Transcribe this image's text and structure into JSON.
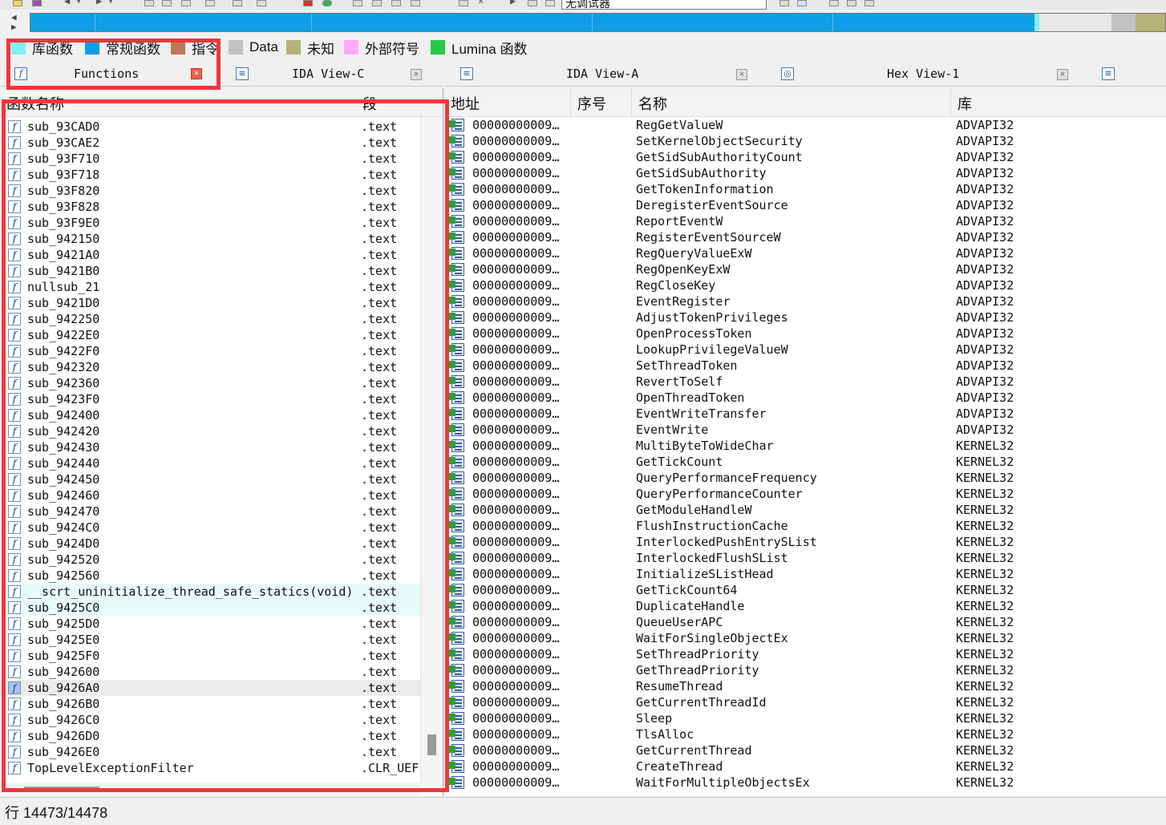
{
  "toolbar": {
    "debugger_select": "无调试器"
  },
  "colors": {
    "library_function": "#7ff0ee",
    "regular_function": "#0c9ee6",
    "instruction": "#c0765a",
    "data": "#c2c2c2",
    "unexplored": "#b5b278",
    "external_symbol": "#ffaaff",
    "lumina_function": "#26c84a",
    "redbox": "#f2353d"
  },
  "legend": [
    {
      "label": "库函数",
      "color": "#7ff0ee"
    },
    {
      "label": "常规函数",
      "color": "#0c9ee6"
    },
    {
      "label": "指令",
      "color": "#c0765a"
    },
    {
      "label": "Data",
      "color": "#c2c2c2"
    },
    {
      "label": "未知",
      "color": "#b5b278"
    },
    {
      "label": "外部符号",
      "color": "#ffaaff"
    },
    {
      "label": "Lumina 函数",
      "color": "#26c84a"
    }
  ],
  "tabs": {
    "functions": "Functions",
    "ida_view_c": "IDA View-C",
    "ida_view_a": "IDA View-A",
    "hex_view": "Hex View-1"
  },
  "functions_panel": {
    "columns": {
      "name": "函数名称",
      "segment": "段"
    },
    "rows": [
      {
        "name": "sub_93CAD0",
        "segment": ".text"
      },
      {
        "name": "sub_93CAE2",
        "segment": ".text"
      },
      {
        "name": "sub_93F710",
        "segment": ".text"
      },
      {
        "name": "sub_93F718",
        "segment": ".text"
      },
      {
        "name": "sub_93F820",
        "segment": ".text"
      },
      {
        "name": "sub_93F828",
        "segment": ".text"
      },
      {
        "name": "sub_93F9E0",
        "segment": ".text"
      },
      {
        "name": "sub_942150",
        "segment": ".text"
      },
      {
        "name": "sub_9421A0",
        "segment": ".text"
      },
      {
        "name": "sub_9421B0",
        "segment": ".text"
      },
      {
        "name": "nullsub_21",
        "segment": ".text"
      },
      {
        "name": "sub_9421D0",
        "segment": ".text"
      },
      {
        "name": "sub_942250",
        "segment": ".text"
      },
      {
        "name": "sub_9422E0",
        "segment": ".text"
      },
      {
        "name": "sub_9422F0",
        "segment": ".text"
      },
      {
        "name": "sub_942320",
        "segment": ".text"
      },
      {
        "name": "sub_942360",
        "segment": ".text"
      },
      {
        "name": "sub_9423F0",
        "segment": ".text"
      },
      {
        "name": "sub_942400",
        "segment": ".text"
      },
      {
        "name": "sub_942420",
        "segment": ".text"
      },
      {
        "name": "sub_942430",
        "segment": ".text"
      },
      {
        "name": "sub_942440",
        "segment": ".text"
      },
      {
        "name": "sub_942450",
        "segment": ".text"
      },
      {
        "name": "sub_942460",
        "segment": ".text"
      },
      {
        "name": "sub_942470",
        "segment": ".text"
      },
      {
        "name": "sub_9424C0",
        "segment": ".text"
      },
      {
        "name": "sub_9424D0",
        "segment": ".text"
      },
      {
        "name": "sub_942520",
        "segment": ".text"
      },
      {
        "name": "sub_942560",
        "segment": ".text"
      },
      {
        "name": "__scrt_uninitialize_thread_safe_statics(void)",
        "segment": ".text",
        "highlight": "blue"
      },
      {
        "name": "sub_9425C0",
        "segment": ".text",
        "highlight": "blue"
      },
      {
        "name": "sub_9425D0",
        "segment": ".text"
      },
      {
        "name": "sub_9425E0",
        "segment": ".text"
      },
      {
        "name": "sub_9425F0",
        "segment": ".text"
      },
      {
        "name": "sub_942600",
        "segment": ".text"
      },
      {
        "name": "sub_9426A0",
        "segment": ".text",
        "highlight": "gray",
        "selected": true
      },
      {
        "name": "sub_9426B0",
        "segment": ".text"
      },
      {
        "name": "sub_9426C0",
        "segment": ".text"
      },
      {
        "name": "sub_9426D0",
        "segment": ".text"
      },
      {
        "name": "sub_9426E0",
        "segment": ".text"
      },
      {
        "name": "TopLevelExceptionFilter",
        "segment": ".CLR_UEF"
      }
    ]
  },
  "imports_panel": {
    "columns": {
      "address": "地址",
      "ordinal": "序号",
      "name": "名称",
      "library": "库"
    },
    "address_prefix": "00000000009…",
    "rows": [
      {
        "name": "RegGetValueW",
        "library": "ADVAPI32"
      },
      {
        "name": "SetKernelObjectSecurity",
        "library": "ADVAPI32"
      },
      {
        "name": "GetSidSubAuthorityCount",
        "library": "ADVAPI32"
      },
      {
        "name": "GetSidSubAuthority",
        "library": "ADVAPI32"
      },
      {
        "name": "GetTokenInformation",
        "library": "ADVAPI32"
      },
      {
        "name": "DeregisterEventSource",
        "library": "ADVAPI32"
      },
      {
        "name": "ReportEventW",
        "library": "ADVAPI32"
      },
      {
        "name": "RegisterEventSourceW",
        "library": "ADVAPI32"
      },
      {
        "name": "RegQueryValueExW",
        "library": "ADVAPI32"
      },
      {
        "name": "RegOpenKeyExW",
        "library": "ADVAPI32"
      },
      {
        "name": "RegCloseKey",
        "library": "ADVAPI32"
      },
      {
        "name": "EventRegister",
        "library": "ADVAPI32"
      },
      {
        "name": "AdjustTokenPrivileges",
        "library": "ADVAPI32"
      },
      {
        "name": "OpenProcessToken",
        "library": "ADVAPI32"
      },
      {
        "name": "LookupPrivilegeValueW",
        "library": "ADVAPI32"
      },
      {
        "name": "SetThreadToken",
        "library": "ADVAPI32"
      },
      {
        "name": "RevertToSelf",
        "library": "ADVAPI32"
      },
      {
        "name": "OpenThreadToken",
        "library": "ADVAPI32"
      },
      {
        "name": "EventWriteTransfer",
        "library": "ADVAPI32"
      },
      {
        "name": "EventWrite",
        "library": "ADVAPI32"
      },
      {
        "name": "MultiByteToWideChar",
        "library": "KERNEL32"
      },
      {
        "name": "GetTickCount",
        "library": "KERNEL32"
      },
      {
        "name": "QueryPerformanceFrequency",
        "library": "KERNEL32"
      },
      {
        "name": "QueryPerformanceCounter",
        "library": "KERNEL32"
      },
      {
        "name": "GetModuleHandleW",
        "library": "KERNEL32"
      },
      {
        "name": "FlushInstructionCache",
        "library": "KERNEL32"
      },
      {
        "name": "InterlockedPushEntrySList",
        "library": "KERNEL32"
      },
      {
        "name": "InterlockedFlushSList",
        "library": "KERNEL32"
      },
      {
        "name": "InitializeSListHead",
        "library": "KERNEL32"
      },
      {
        "name": "GetTickCount64",
        "library": "KERNEL32"
      },
      {
        "name": "DuplicateHandle",
        "library": "KERNEL32"
      },
      {
        "name": "QueueUserAPC",
        "library": "KERNEL32"
      },
      {
        "name": "WaitForSingleObjectEx",
        "library": "KERNEL32"
      },
      {
        "name": "SetThreadPriority",
        "library": "KERNEL32"
      },
      {
        "name": "GetThreadPriority",
        "library": "KERNEL32"
      },
      {
        "name": "ResumeThread",
        "library": "KERNEL32"
      },
      {
        "name": "GetCurrentThreadId",
        "library": "KERNEL32"
      },
      {
        "name": "Sleep",
        "library": "KERNEL32"
      },
      {
        "name": "TlsAlloc",
        "library": "KERNEL32"
      },
      {
        "name": "GetCurrentThread",
        "library": "KERNEL32"
      },
      {
        "name": "CreateThread",
        "library": "KERNEL32"
      },
      {
        "name": "WaitForMultipleObjectsEx",
        "library": "KERNEL32"
      }
    ]
  },
  "status": {
    "line": "行 14473/14478"
  }
}
